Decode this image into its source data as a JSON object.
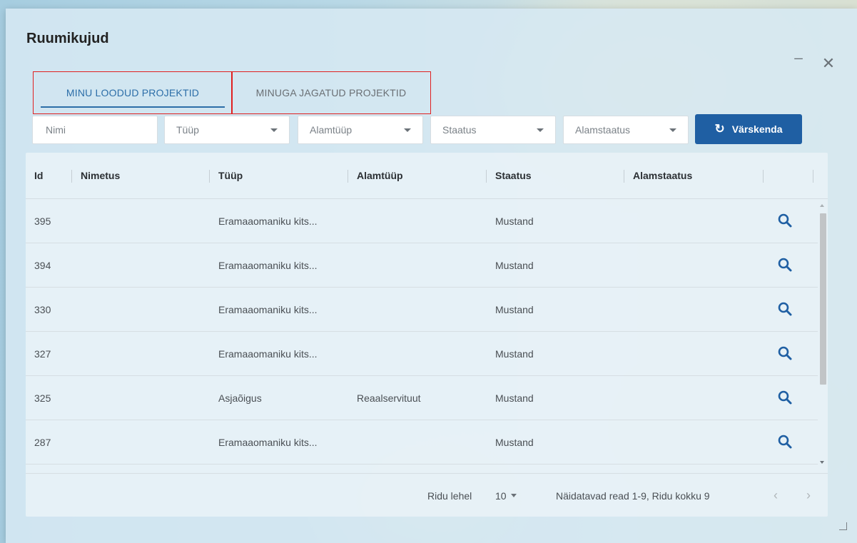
{
  "window": {
    "title": "Ruumikujud",
    "minimize_glyph": "_",
    "close_glyph": "✕"
  },
  "tabs": [
    {
      "label": "MINU LOODUD PROJEKTID",
      "active": true
    },
    {
      "label": "MINUGA JAGATUD PROJEKTID",
      "active": false
    }
  ],
  "filters": {
    "name_placeholder": "Nimi",
    "type_placeholder": "Tüüp",
    "subtype_placeholder": "Alamtüüp",
    "status_placeholder": "Staatus",
    "substatus_placeholder": "Alamstaatus",
    "refresh_icon": "↻",
    "refresh_label": "Värskenda"
  },
  "table": {
    "columns": [
      "Id",
      "Nimetus",
      "Tüüp",
      "Alamtüüp",
      "Staatus",
      "Alamstaatus"
    ],
    "rows": [
      {
        "id": "395",
        "name": "",
        "type": "Eramaaomaniku kits...",
        "subtype": "",
        "status": "Mustand",
        "substatus": ""
      },
      {
        "id": "394",
        "name": "",
        "type": "Eramaaomaniku kits...",
        "subtype": "",
        "status": "Mustand",
        "substatus": ""
      },
      {
        "id": "330",
        "name": "",
        "type": "Eramaaomaniku kits...",
        "subtype": "",
        "status": "Mustand",
        "substatus": ""
      },
      {
        "id": "327",
        "name": "",
        "type": "Eramaaomaniku kits...",
        "subtype": "",
        "status": "Mustand",
        "substatus": ""
      },
      {
        "id": "325",
        "name": "",
        "type": "Asjaõigus",
        "subtype": "Reaalservituut",
        "status": "Mustand",
        "substatus": ""
      },
      {
        "id": "287",
        "name": "",
        "type": "Eramaaomaniku kits...",
        "subtype": "",
        "status": "Mustand",
        "substatus": ""
      }
    ],
    "row_action_icon": "search-icon"
  },
  "footer": {
    "rows_per_page_label": "Ridu lehel",
    "rows_per_page_value": "10",
    "summary": "Näidatavad read 1-9, Ridu kokku 9",
    "prev_glyph": "‹",
    "next_glyph": "›"
  },
  "colors": {
    "accent": "#1f5fa3",
    "tab_active": "#2c6ea8",
    "highlight_border": "#e02020"
  }
}
